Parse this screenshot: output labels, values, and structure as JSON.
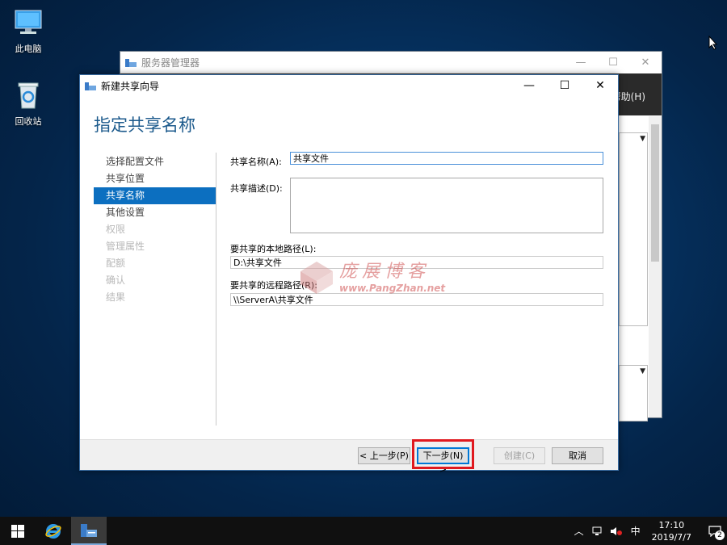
{
  "desktop": {
    "icons": [
      {
        "label": "此电脑"
      },
      {
        "label": "回收站"
      }
    ]
  },
  "background_window": {
    "title": "服务器管理器",
    "menu_help": "帮助(H)"
  },
  "wizard": {
    "title": "新建共享向导",
    "heading": "指定共享名称",
    "nav": [
      {
        "label": "选择配置文件",
        "state": "normal"
      },
      {
        "label": "共享位置",
        "state": "normal"
      },
      {
        "label": "共享名称",
        "state": "active"
      },
      {
        "label": "其他设置",
        "state": "normal"
      },
      {
        "label": "权限",
        "state": "disabled"
      },
      {
        "label": "管理属性",
        "state": "disabled"
      },
      {
        "label": "配额",
        "state": "disabled"
      },
      {
        "label": "确认",
        "state": "disabled"
      },
      {
        "label": "结果",
        "state": "disabled"
      }
    ],
    "form": {
      "share_name_label": "共享名称(A):",
      "share_name_value": "共享文件",
      "share_desc_label": "共享描述(D):",
      "share_desc_value": "",
      "local_path_label": "要共享的本地路径(L):",
      "local_path_value": "D:\\共享文件",
      "remote_path_label": "要共享的远程路径(R):",
      "remote_path_value": "\\\\ServerA\\共享文件"
    },
    "buttons": {
      "prev": "< 上一步(P)",
      "next": "下一步(N) >",
      "create": "创建(C)",
      "cancel": "取消"
    }
  },
  "watermark": {
    "title": "庞展博客",
    "url": "www.PangZhan.net"
  },
  "taskbar": {
    "ime": "中",
    "time": "17:10",
    "date": "2019/7/7",
    "notification_count": "2"
  },
  "colors": {
    "accent": "#0c6fc0",
    "heading": "#1c5a8c",
    "highlight_box": "#e0191f"
  }
}
